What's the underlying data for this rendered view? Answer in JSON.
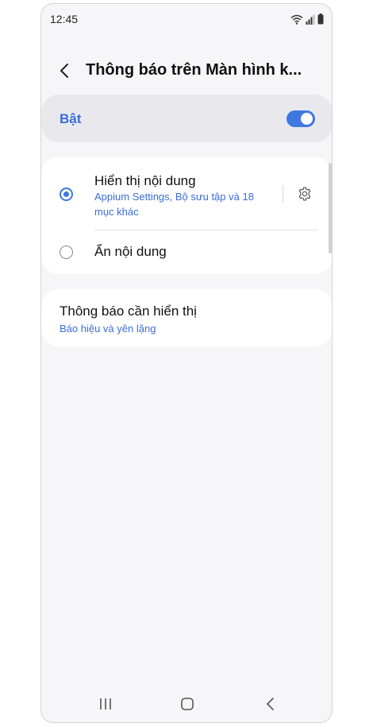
{
  "status_bar": {
    "time": "12:45",
    "icons": [
      "wifi-icon",
      "signal-icon",
      "battery-icon"
    ]
  },
  "header": {
    "back_icon": "chevron-left-icon",
    "title": "Thông báo trên Màn hình k..."
  },
  "master_switch": {
    "label": "Bật",
    "state": "on"
  },
  "options": [
    {
      "title": "Hiển thị nội dung",
      "subtitle": "Appium Settings, Bộ sưu tập và 18 mục khác",
      "selected": true,
      "settings_icon": "gear-icon"
    },
    {
      "title": "Ẩn nội dung",
      "selected": false
    }
  ],
  "notifications_to_show": {
    "title": "Thông báo cần hiển thị",
    "subtitle": "Báo hiệu và yên lặng"
  },
  "nav_bar": {
    "icons": [
      "recents-icon",
      "home-icon",
      "back-nav-icon"
    ]
  },
  "colors": {
    "accent": "#3f78e0",
    "link_text": "#3a6dd9",
    "background": "#f6f6f8",
    "card": "#ffffff",
    "master_card": "#e9e9ed"
  }
}
